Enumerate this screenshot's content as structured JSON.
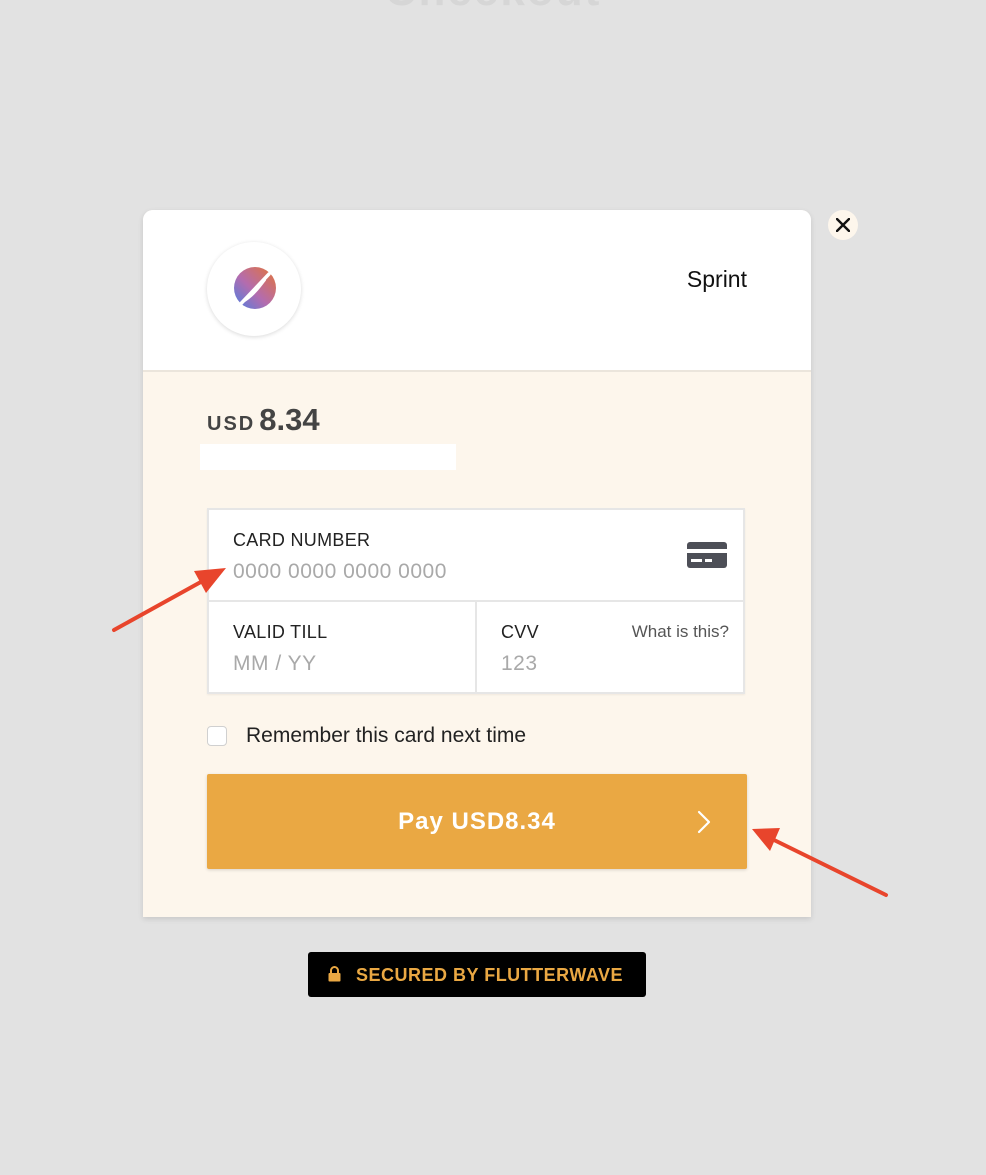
{
  "page": {
    "background_title": "Checkout"
  },
  "modal": {
    "merchant_name": "Sprint",
    "amount": {
      "currency": "USD",
      "value": "8.34"
    },
    "card_form": {
      "card_number": {
        "label": "CARD NUMBER",
        "placeholder": "0000 0000 0000 0000",
        "icon": "credit-card-icon"
      },
      "valid_till": {
        "label": "VALID TILL",
        "placeholder": "MM / YY"
      },
      "cvv": {
        "label": "CVV",
        "placeholder": "123",
        "help_link": "What is this?"
      }
    },
    "remember_card": {
      "label": "Remember this card next time",
      "checked": false
    },
    "pay_button": {
      "label": "Pay USD8.34",
      "icon": "chevron-right-icon"
    },
    "close_icon": "close-icon"
  },
  "secured_badge": {
    "label": "SECURED BY FLUTTERWAVE",
    "icon": "lock-icon"
  },
  "colors": {
    "accent": "#eaa843",
    "annotation_arrow": "#e8452c",
    "form_background": "#fdf6ec",
    "page_background": "#e2e2e2"
  }
}
